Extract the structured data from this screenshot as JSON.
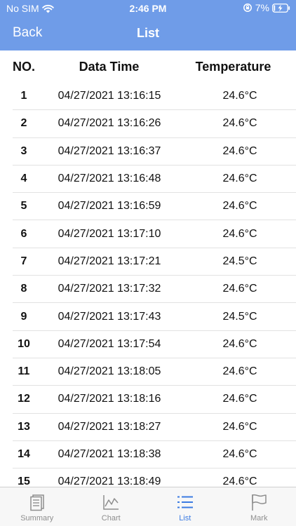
{
  "status_bar": {
    "carrier": "No SIM",
    "time": "2:46 PM",
    "battery": "7%"
  },
  "nav": {
    "back_label": "Back",
    "title": "List"
  },
  "columns": {
    "no": "NO.",
    "time": "Data Time",
    "temperature": "Temperature"
  },
  "rows": [
    {
      "no": "1",
      "time": "04/27/2021 13:16:15",
      "temp": "24.6°C"
    },
    {
      "no": "2",
      "time": "04/27/2021 13:16:26",
      "temp": "24.6°C"
    },
    {
      "no": "3",
      "time": "04/27/2021 13:16:37",
      "temp": "24.6°C"
    },
    {
      "no": "4",
      "time": "04/27/2021 13:16:48",
      "temp": "24.6°C"
    },
    {
      "no": "5",
      "time": "04/27/2021 13:16:59",
      "temp": "24.6°C"
    },
    {
      "no": "6",
      "time": "04/27/2021 13:17:10",
      "temp": "24.6°C"
    },
    {
      "no": "7",
      "time": "04/27/2021 13:17:21",
      "temp": "24.5°C"
    },
    {
      "no": "8",
      "time": "04/27/2021 13:17:32",
      "temp": "24.6°C"
    },
    {
      "no": "9",
      "time": "04/27/2021 13:17:43",
      "temp": "24.5°C"
    },
    {
      "no": "10",
      "time": "04/27/2021 13:17:54",
      "temp": "24.6°C"
    },
    {
      "no": "11",
      "time": "04/27/2021 13:18:05",
      "temp": "24.6°C"
    },
    {
      "no": "12",
      "time": "04/27/2021 13:18:16",
      "temp": "24.6°C"
    },
    {
      "no": "13",
      "time": "04/27/2021 13:18:27",
      "temp": "24.6°C"
    },
    {
      "no": "14",
      "time": "04/27/2021 13:18:38",
      "temp": "24.6°C"
    },
    {
      "no": "15",
      "time": "04/27/2021 13:18:49",
      "temp": "24.6°C"
    }
  ],
  "tabs": [
    {
      "label": "Summary",
      "icon": "summary-icon"
    },
    {
      "label": "Chart",
      "icon": "chart-icon"
    },
    {
      "label": "List",
      "icon": "list-icon",
      "active": true
    },
    {
      "label": "Mark",
      "icon": "flag-icon"
    }
  ],
  "colors": {
    "header": "#6f9ce8",
    "active_tab": "#3b7be2",
    "inactive_tab": "#8e8e8e"
  }
}
